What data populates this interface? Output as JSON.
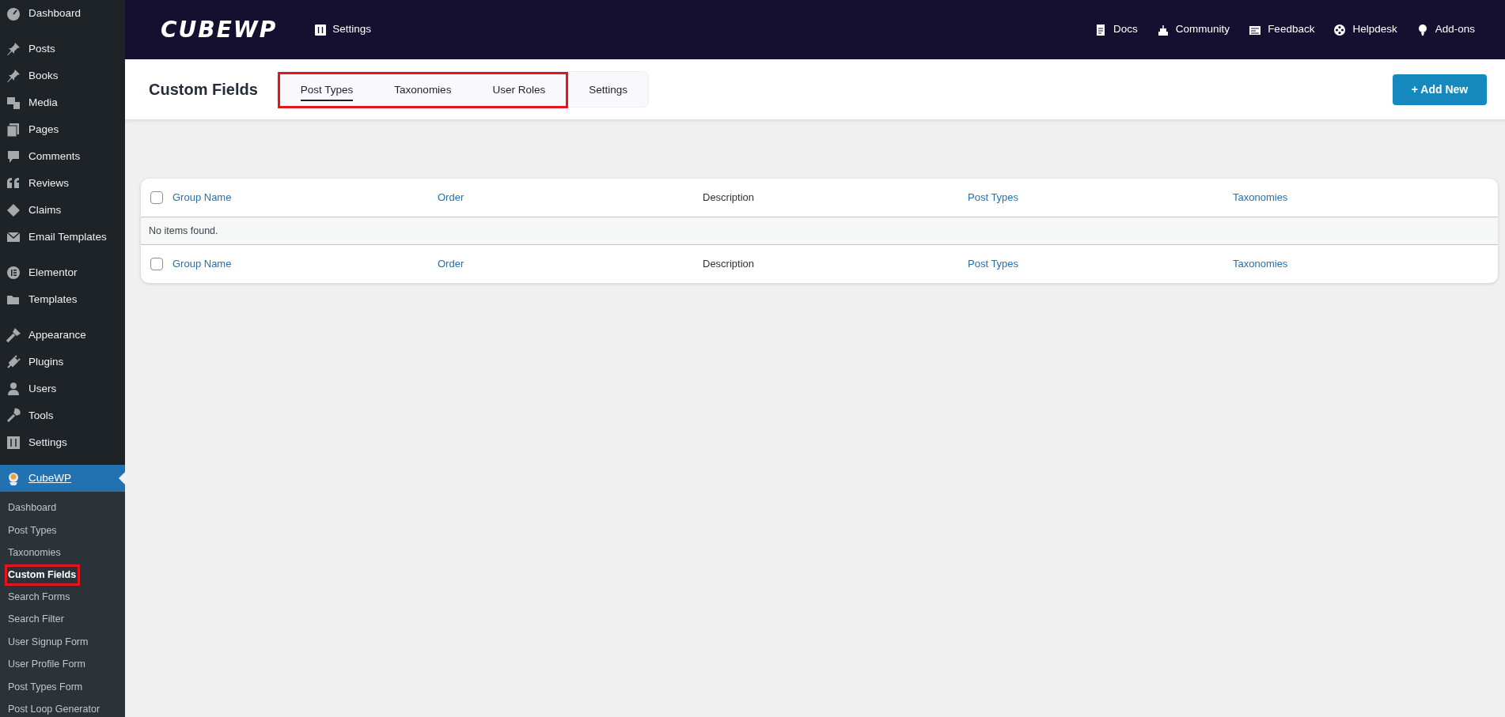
{
  "sidebar": {
    "groups": [
      {
        "items": [
          {
            "label": "Dashboard"
          }
        ]
      },
      {
        "items": [
          {
            "label": "Posts"
          },
          {
            "label": "Books"
          },
          {
            "label": "Media"
          },
          {
            "label": "Pages"
          },
          {
            "label": "Comments"
          },
          {
            "label": "Reviews"
          },
          {
            "label": "Claims"
          },
          {
            "label": "Email Templates"
          }
        ]
      },
      {
        "items": [
          {
            "label": "Elementor"
          },
          {
            "label": "Templates"
          }
        ]
      },
      {
        "items": [
          {
            "label": "Appearance"
          },
          {
            "label": "Plugins"
          },
          {
            "label": "Users"
          },
          {
            "label": "Tools"
          },
          {
            "label": "Settings"
          }
        ]
      }
    ],
    "active_menu": {
      "label": "CubeWP",
      "selected": true,
      "submenu": [
        {
          "label": "Dashboard",
          "selected": false,
          "highlighted": false
        },
        {
          "label": "Post Types",
          "selected": false,
          "highlighted": false
        },
        {
          "label": "Taxonomies",
          "selected": false,
          "highlighted": false
        },
        {
          "label": "Custom Fields",
          "selected": true,
          "highlighted": true
        },
        {
          "label": "Search Forms",
          "selected": false,
          "highlighted": false
        },
        {
          "label": "Search Filter",
          "selected": false,
          "highlighted": false
        },
        {
          "label": "User Signup Form",
          "selected": false,
          "highlighted": false
        },
        {
          "label": "User Profile Form",
          "selected": false,
          "highlighted": false
        },
        {
          "label": "Post Types Form",
          "selected": false,
          "highlighted": false
        },
        {
          "label": "Post Loop Generator",
          "selected": false,
          "highlighted": false
        }
      ]
    }
  },
  "topbar": {
    "logo": "CUBEWP",
    "settings_link": "Settings",
    "links": [
      "Docs",
      "Community",
      "Feedback",
      "Helpdesk",
      "Add-ons"
    ]
  },
  "header": {
    "title": "Custom Fields",
    "tabs": [
      {
        "label": "Post Types",
        "selected": true,
        "highlighted": true
      },
      {
        "label": "Taxonomies",
        "selected": false,
        "highlighted": true
      },
      {
        "label": "User Roles",
        "selected": false,
        "highlighted": true
      },
      {
        "label": "Settings",
        "selected": false,
        "highlighted": false
      }
    ],
    "add_button": "+ Add New"
  },
  "table": {
    "columns": [
      {
        "label": "Group Name",
        "sortable": true
      },
      {
        "label": "Order",
        "sortable": true
      },
      {
        "label": "Description",
        "sortable": false
      },
      {
        "label": "Post Types",
        "sortable": true
      },
      {
        "label": "Taxonomies",
        "sortable": true
      }
    ],
    "select_all_checked": false,
    "empty_message": "No items found.",
    "footer_columns": [
      {
        "label": "Group Name",
        "sortable": true
      },
      {
        "label": "Order",
        "sortable": true
      },
      {
        "label": "Description",
        "sortable": false
      },
      {
        "label": "Post Types",
        "sortable": true
      },
      {
        "label": "Taxonomies",
        "sortable": true
      }
    ],
    "footer_select_all_checked": false
  }
}
